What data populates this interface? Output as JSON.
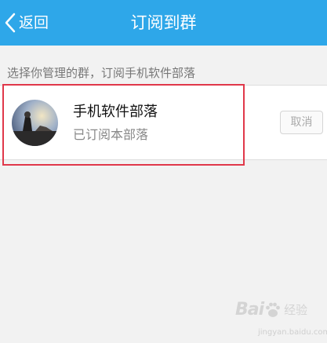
{
  "header": {
    "back_label": "返回",
    "title": "订阅到群",
    "background": "#2ea7e9"
  },
  "hint": "选择你管理的群，订阅手机软件部落",
  "group": {
    "name": "手机软件部落",
    "status": "已订阅本部落",
    "action_label": "取消",
    "avatar_icon": "group-avatar-photo"
  },
  "highlight": {
    "color": "#e0384a"
  },
  "watermark": {
    "logo": "Bai",
    "logo_suffix": "du",
    "text": "经验",
    "url": "jingyan.baidu.com"
  }
}
